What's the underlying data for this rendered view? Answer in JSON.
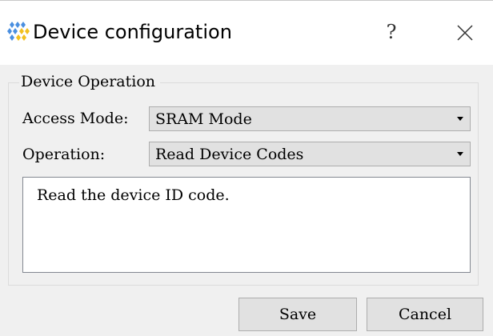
{
  "window": {
    "title": "Device configuration",
    "help_label": "?",
    "app_icon": "app-logo-icon",
    "close_icon": "close-icon"
  },
  "group": {
    "title": "Device Operation"
  },
  "access_mode": {
    "label": "Access Mode:",
    "value": "SRAM Mode"
  },
  "operation": {
    "label": "Operation:",
    "value": "Read Device Codes"
  },
  "description": {
    "text": "Read the device ID code."
  },
  "buttons": {
    "save": "Save",
    "cancel": "Cancel"
  },
  "colors": {
    "titlebar": "#ffffff",
    "dialog_bg": "#f0f0f0",
    "button_bg": "#e1e1e1",
    "icon_blue": "#4a8fe0",
    "icon_yellow": "#f2c01e"
  }
}
